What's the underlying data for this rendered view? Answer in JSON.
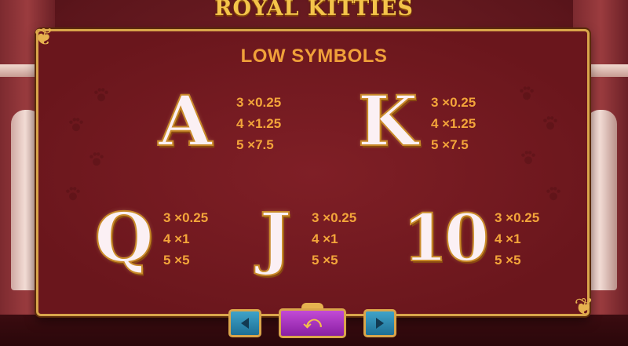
{
  "header": {
    "logo_text": "ROYAL KITTIES"
  },
  "paytable": {
    "title": "LOW SYMBOLS",
    "symbols": [
      {
        "symbol": "A",
        "pays": [
          "3 ×0.25",
          "4 ×1.25",
          "5 ×7.5"
        ]
      },
      {
        "symbol": "K",
        "pays": [
          "3 ×0.25",
          "4 ×1.25",
          "5 ×7.5"
        ]
      },
      {
        "symbol": "Q",
        "pays": [
          "3 ×0.25",
          "4 ×1",
          "5 ×5"
        ]
      },
      {
        "symbol": "J",
        "pays": [
          "3 ×0.25",
          "4 ×1",
          "5 ×5"
        ]
      },
      {
        "symbol": "10",
        "pays": [
          "3 ×0.25",
          "4 ×1",
          "5 ×5"
        ]
      }
    ]
  },
  "navigation": {
    "prev_icon": "arrow-left-icon",
    "back_icon": "return-arrow-icon",
    "next_icon": "arrow-right-icon"
  },
  "colors": {
    "panel": "#741a20",
    "gold": "#d9a54b",
    "title": "#f0a13a",
    "nav_blue": "#2f8fb8",
    "nav_purple": "#a532c0"
  }
}
